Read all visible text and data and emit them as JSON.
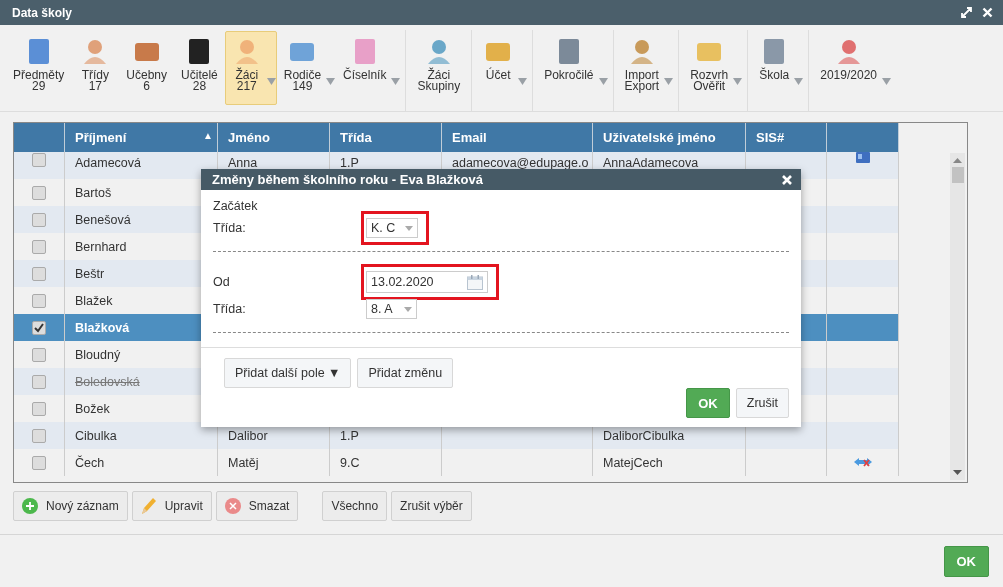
{
  "window": {
    "title": "Data školy"
  },
  "toolbar": [
    {
      "lines": [
        "Předměty",
        "29"
      ],
      "dropdown": false,
      "selected": false
    },
    {
      "lines": [
        "Třídy",
        "17"
      ],
      "dropdown": false,
      "selected": false
    },
    {
      "lines": [
        "Učebny",
        "6"
      ],
      "dropdown": false,
      "selected": false
    },
    {
      "lines": [
        "Učitelé",
        "28"
      ],
      "dropdown": false,
      "selected": false
    },
    {
      "lines": [
        "Žáci",
        "217"
      ],
      "dropdown": true,
      "selected": true
    },
    {
      "lines": [
        "Rodiče",
        "149"
      ],
      "dropdown": true,
      "selected": false
    },
    {
      "lines": [
        "Číselník"
      ],
      "dropdown": true,
      "selected": false
    },
    {
      "lines": [
        "Žáci",
        "Skupiny"
      ],
      "dropdown": false,
      "selected": false
    },
    {
      "lines": [
        "Účet"
      ],
      "dropdown": true,
      "selected": false
    },
    {
      "lines": [
        "Pokročilé"
      ],
      "dropdown": true,
      "selected": false
    },
    {
      "lines": [
        "Import",
        "Export"
      ],
      "dropdown": true,
      "selected": false
    },
    {
      "lines": [
        "Rozvrh",
        "Ověřit"
      ],
      "dropdown": true,
      "selected": false
    },
    {
      "lines": [
        "Škola"
      ],
      "dropdown": true,
      "selected": false
    },
    {
      "lines": [
        "2019/2020"
      ],
      "dropdown": true,
      "selected": false
    }
  ],
  "table": {
    "columns": [
      {
        "label": "Příjmení",
        "sort": "▲"
      },
      {
        "label": "Jméno"
      },
      {
        "label": "Třída"
      },
      {
        "label": "Email"
      },
      {
        "label": "Uživatelské jméno"
      },
      {
        "label": "SIS#"
      }
    ],
    "rows": [
      {
        "surname": "Adamecová",
        "first_name": "Anna",
        "class": "1.P",
        "email": "adamecova@edupage.o",
        "username": "AnnaAdamecova",
        "checked": false,
        "selected": false,
        "struck": false,
        "kind": "card"
      },
      {
        "surname": "Bartoš",
        "checked": false,
        "selected": false,
        "struck": false
      },
      {
        "surname": "Benešová",
        "checked": false,
        "selected": false,
        "struck": false
      },
      {
        "surname": "Bernhard",
        "checked": false,
        "selected": false,
        "struck": false
      },
      {
        "surname": "Beštr",
        "checked": false,
        "selected": false,
        "struck": false
      },
      {
        "surname": "Blažek",
        "checked": false,
        "selected": false,
        "struck": false
      },
      {
        "surname": "Blažková",
        "checked": true,
        "selected": true,
        "struck": false
      },
      {
        "surname": "Bloudný",
        "checked": false,
        "selected": false,
        "struck": false
      },
      {
        "surname": "Boledovská",
        "checked": false,
        "selected": false,
        "struck": true
      },
      {
        "surname": "Božek",
        "checked": false,
        "selected": false,
        "struck": false
      },
      {
        "surname": "Cibulka",
        "first_name": "Dalibor",
        "class": "1.P",
        "username": "DaliborCibulka",
        "checked": false,
        "selected": false,
        "struck": false
      },
      {
        "surname": "Čech",
        "first_name": "Matěj",
        "class": "9.C",
        "username": "MatejCech",
        "checked": false,
        "selected": false,
        "struck": false,
        "kind": "unlink"
      }
    ]
  },
  "actions": [
    {
      "label": "Nový záznam",
      "kind": "add"
    },
    {
      "label": "Upravit",
      "kind": "edit"
    },
    {
      "label": "Smazat",
      "kind": "delete"
    },
    {
      "label": "Všechno",
      "kind": "plain"
    },
    {
      "label": "Zrušit výběr",
      "kind": "plain"
    }
  ],
  "dialog": {
    "title": "Změny během školního roku - Eva Blažková",
    "sections": [
      {
        "label": "Začátek",
        "class_label": "Třída:",
        "class_value": "K. C",
        "class_highlighted": true
      },
      {
        "label": "Od",
        "date": "13.02.2020",
        "date_highlighted": true,
        "class_label": "Třída:",
        "class_value": "8. A",
        "class_highlighted": false
      }
    ],
    "buttons": [
      {
        "label": "Přidat další pole ▼"
      },
      {
        "label": "Přidat změnu"
      }
    ],
    "footer_buttons": [
      {
        "label": "OK",
        "kind": "primary"
      },
      {
        "label": "Zrušit",
        "kind": "plain"
      }
    ]
  },
  "footer": {
    "ok": "OK"
  }
}
